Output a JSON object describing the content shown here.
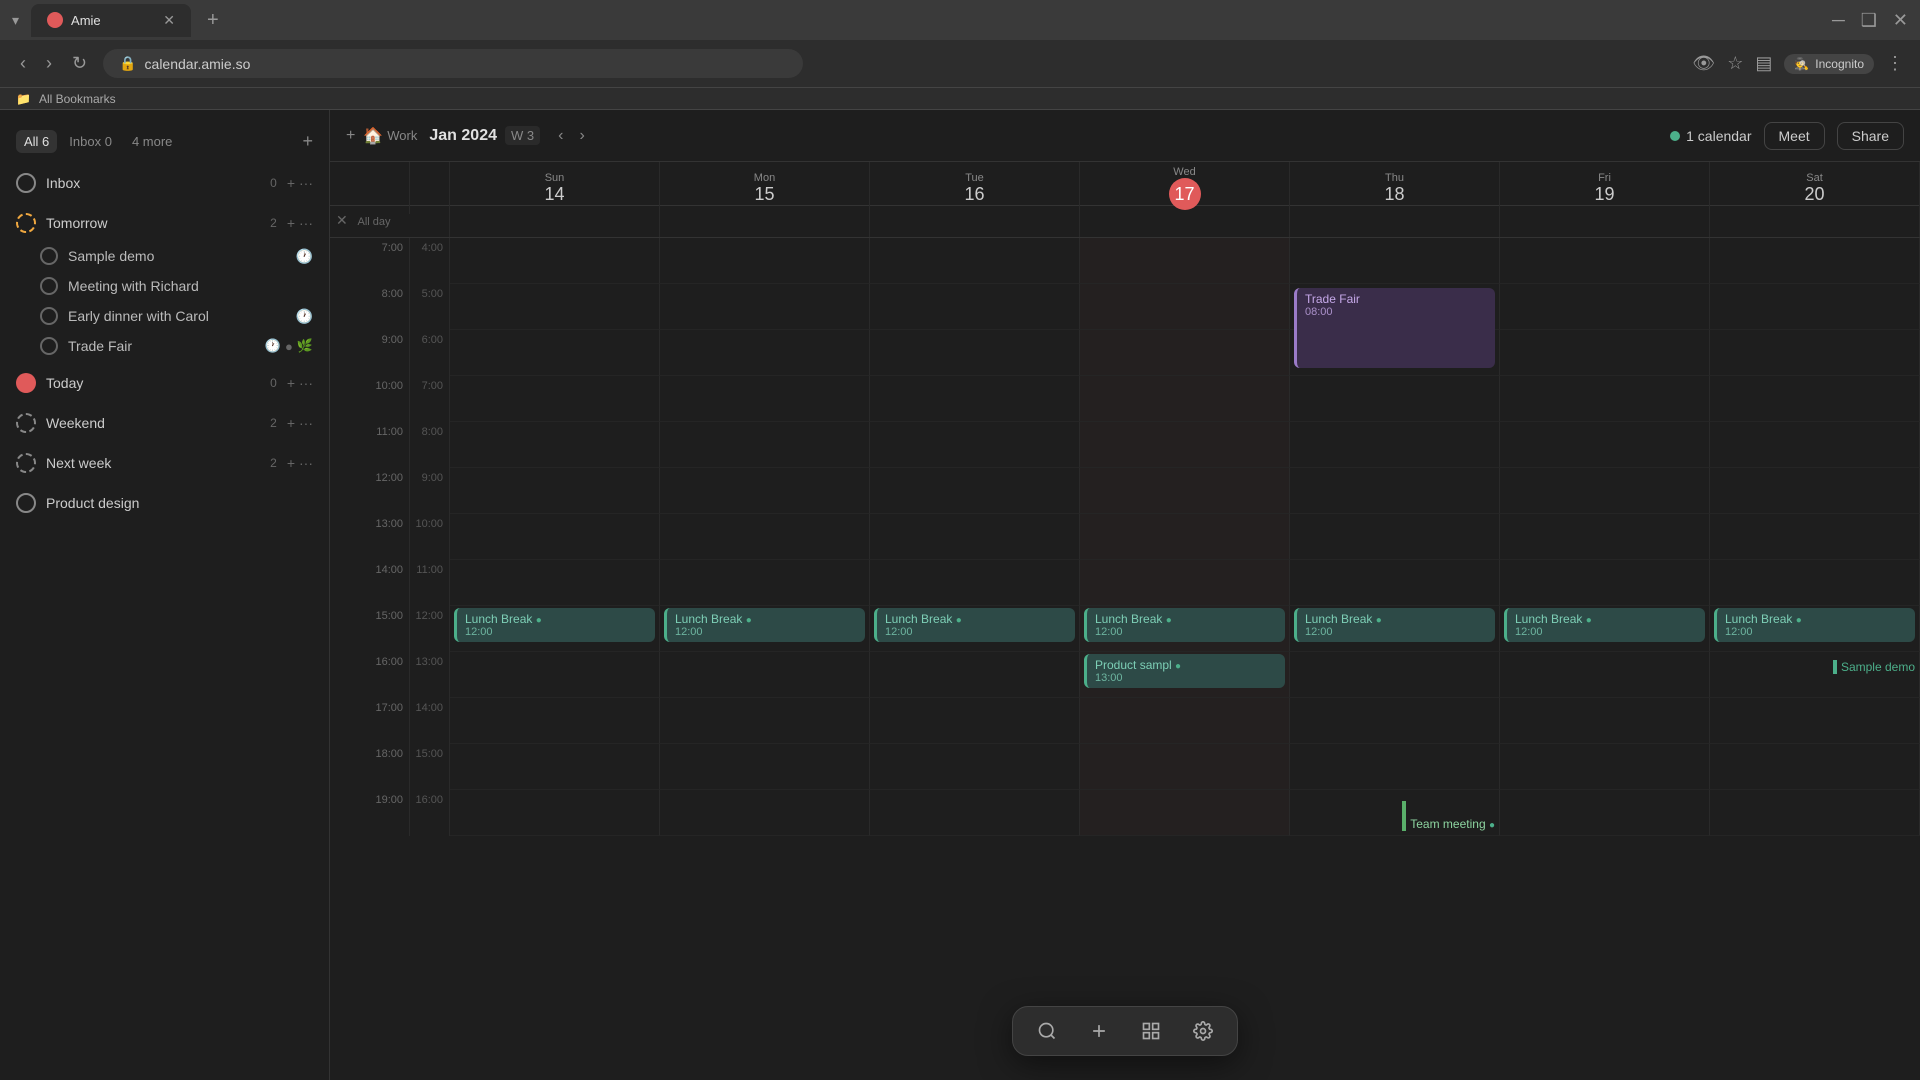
{
  "browser": {
    "tab_title": "Amie",
    "tab_favicon": "A",
    "url": "calendar.amie.so",
    "incognito_label": "Incognito",
    "bookmarks_label": "All Bookmarks"
  },
  "sidebar": {
    "tabs": [
      {
        "label": "All",
        "count": "6",
        "active": true
      },
      {
        "label": "Inbox",
        "count": "0",
        "active": false
      },
      {
        "label": "4 more",
        "active": false
      }
    ],
    "sections": [
      {
        "label": "Inbox",
        "count": "0",
        "icon_type": "circle",
        "has_add": true,
        "items": []
      },
      {
        "label": "Tomorrow",
        "count": "2",
        "icon_type": "dashed",
        "has_add": true,
        "items": [
          {
            "label": "Sample demo",
            "badge": "clock"
          },
          {
            "label": "Meeting with Richard"
          },
          {
            "label": "Early dinner with Carol",
            "badge": "clock"
          },
          {
            "label": "Trade Fair",
            "badges": [
              "clock",
              "dot",
              "leaf"
            ]
          }
        ]
      },
      {
        "label": "Today",
        "count": "0",
        "icon_type": "circle",
        "has_add": true,
        "items": []
      },
      {
        "label": "Weekend",
        "count": "2",
        "icon_type": "dashed",
        "has_add": true,
        "items": []
      },
      {
        "label": "Next week",
        "count": "2",
        "icon_type": "dashed",
        "has_add": true,
        "items": []
      },
      {
        "label": "Product design",
        "count": "",
        "icon_type": "circle",
        "has_add": false,
        "items": []
      }
    ]
  },
  "calendar": {
    "title": "Jan 2024",
    "week": "W 3",
    "calendar_count": "1 calendar",
    "meet_label": "Meet",
    "share_label": "Share",
    "days": [
      {
        "name": "Sun",
        "num": "14",
        "today": false
      },
      {
        "name": "Mon",
        "num": "15",
        "today": false
      },
      {
        "name": "Tue",
        "num": "16",
        "today": false
      },
      {
        "name": "Wed",
        "num": "17",
        "today": true
      },
      {
        "name": "Thu",
        "num": "18",
        "today": false
      },
      {
        "name": "Fri",
        "num": "19",
        "today": false
      },
      {
        "name": "Sat",
        "num": "20",
        "today": false
      }
    ],
    "allday_label": "All day",
    "time_slots": [
      {
        "main": "7:00",
        "alt": "4:00"
      },
      {
        "main": "8:00",
        "alt": "5:00"
      },
      {
        "main": "9:00",
        "alt": "6:00"
      },
      {
        "main": "10:00",
        "alt": "7:00"
      },
      {
        "main": "11:00",
        "alt": "8:00"
      },
      {
        "main": "12:00",
        "alt": "9:00"
      },
      {
        "main": "13:00",
        "alt": "10:00"
      },
      {
        "main": "14:00",
        "alt": "11:00"
      },
      {
        "main": "15:00",
        "alt": "12:00"
      },
      {
        "main": "16:00",
        "alt": "13:00"
      },
      {
        "main": "17:00",
        "alt": "14:00"
      },
      {
        "main": "18:00",
        "alt": "15:00"
      },
      {
        "main": "19:00",
        "alt": "16:00"
      }
    ],
    "events": {
      "trade_fair": {
        "name": "Trade Fair",
        "time": "08:00",
        "day_col": 5,
        "row_start": 2,
        "color": "purple"
      },
      "lunch_breaks": [
        {
          "day": 0,
          "time": "12:00"
        },
        {
          "day": 1,
          "time": "12:00"
        },
        {
          "day": 2,
          "time": "12:00"
        },
        {
          "day": 3,
          "time": "12:00"
        },
        {
          "day": 4,
          "time": "12:00"
        },
        {
          "day": 5,
          "time": "12:00"
        },
        {
          "day": 6,
          "time": "12:00"
        }
      ],
      "product_sample": {
        "name": "Product sampl",
        "time": "13:00",
        "day_col": 3
      },
      "sample_demo": {
        "name": "Sample demo",
        "day_col": 6
      },
      "team_meeting": {
        "name": "Team meeting",
        "day_col": 5
      }
    }
  },
  "floating_toolbar": {
    "search_icon": "search",
    "add_icon": "plus",
    "view_icon": "grid",
    "settings_icon": "gear"
  }
}
